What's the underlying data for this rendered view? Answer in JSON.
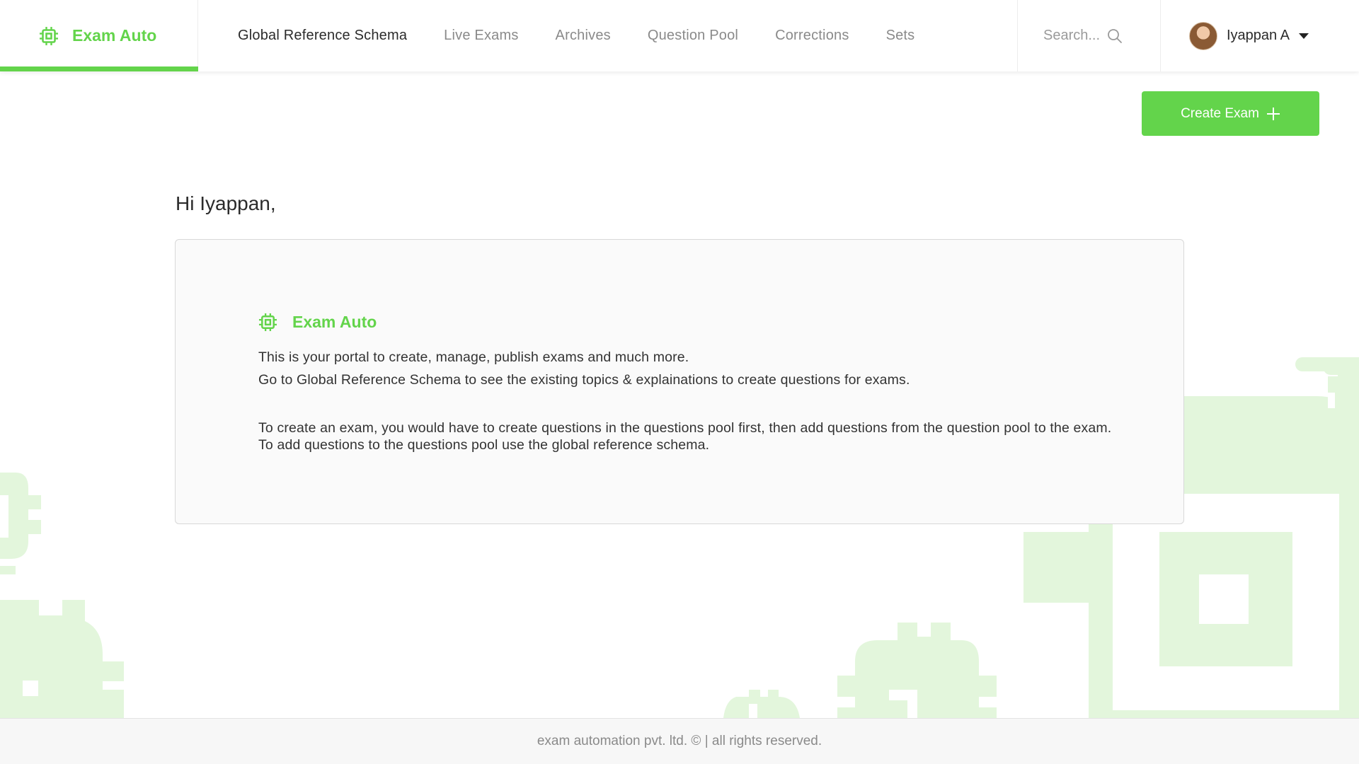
{
  "brand": {
    "name": "Exam Auto",
    "icon": "chip-icon",
    "color": "#63d44b"
  },
  "nav": {
    "items": [
      {
        "label": "Global Reference Schema",
        "active": true
      },
      {
        "label": "Live Exams",
        "active": false
      },
      {
        "label": "Archives",
        "active": false
      },
      {
        "label": "Question Pool",
        "active": false
      },
      {
        "label": "Corrections",
        "active": false
      },
      {
        "label": "Sets",
        "active": false
      }
    ]
  },
  "search": {
    "placeholder": "Search...",
    "icon": "search-icon"
  },
  "user": {
    "name": "Iyappan A",
    "icon": "caret-down-icon"
  },
  "actions": {
    "create_exam_label": "Create Exam",
    "icon": "plus-icon"
  },
  "main": {
    "greeting": "Hi Iyappan,",
    "card": {
      "brand": "Exam Auto",
      "line1": "This is your portal to create, manage, publish exams and much more.",
      "line2": "Go to Global Reference Schema to see the existing topics & explainations to create questions for exams.",
      "paragraph": "To create an exam, you would have to create questions in the questions pool first, then add questions from the question pool to the exam. To add questions to the questions pool use the global reference schema."
    }
  },
  "footer": {
    "text": "exam automation pvt. ltd. © | all rights reserved."
  },
  "colors": {
    "accent": "#63d44b",
    "deco": "#e3f6dc",
    "text": "#2b2b2b",
    "muted": "#8a8a8a"
  }
}
